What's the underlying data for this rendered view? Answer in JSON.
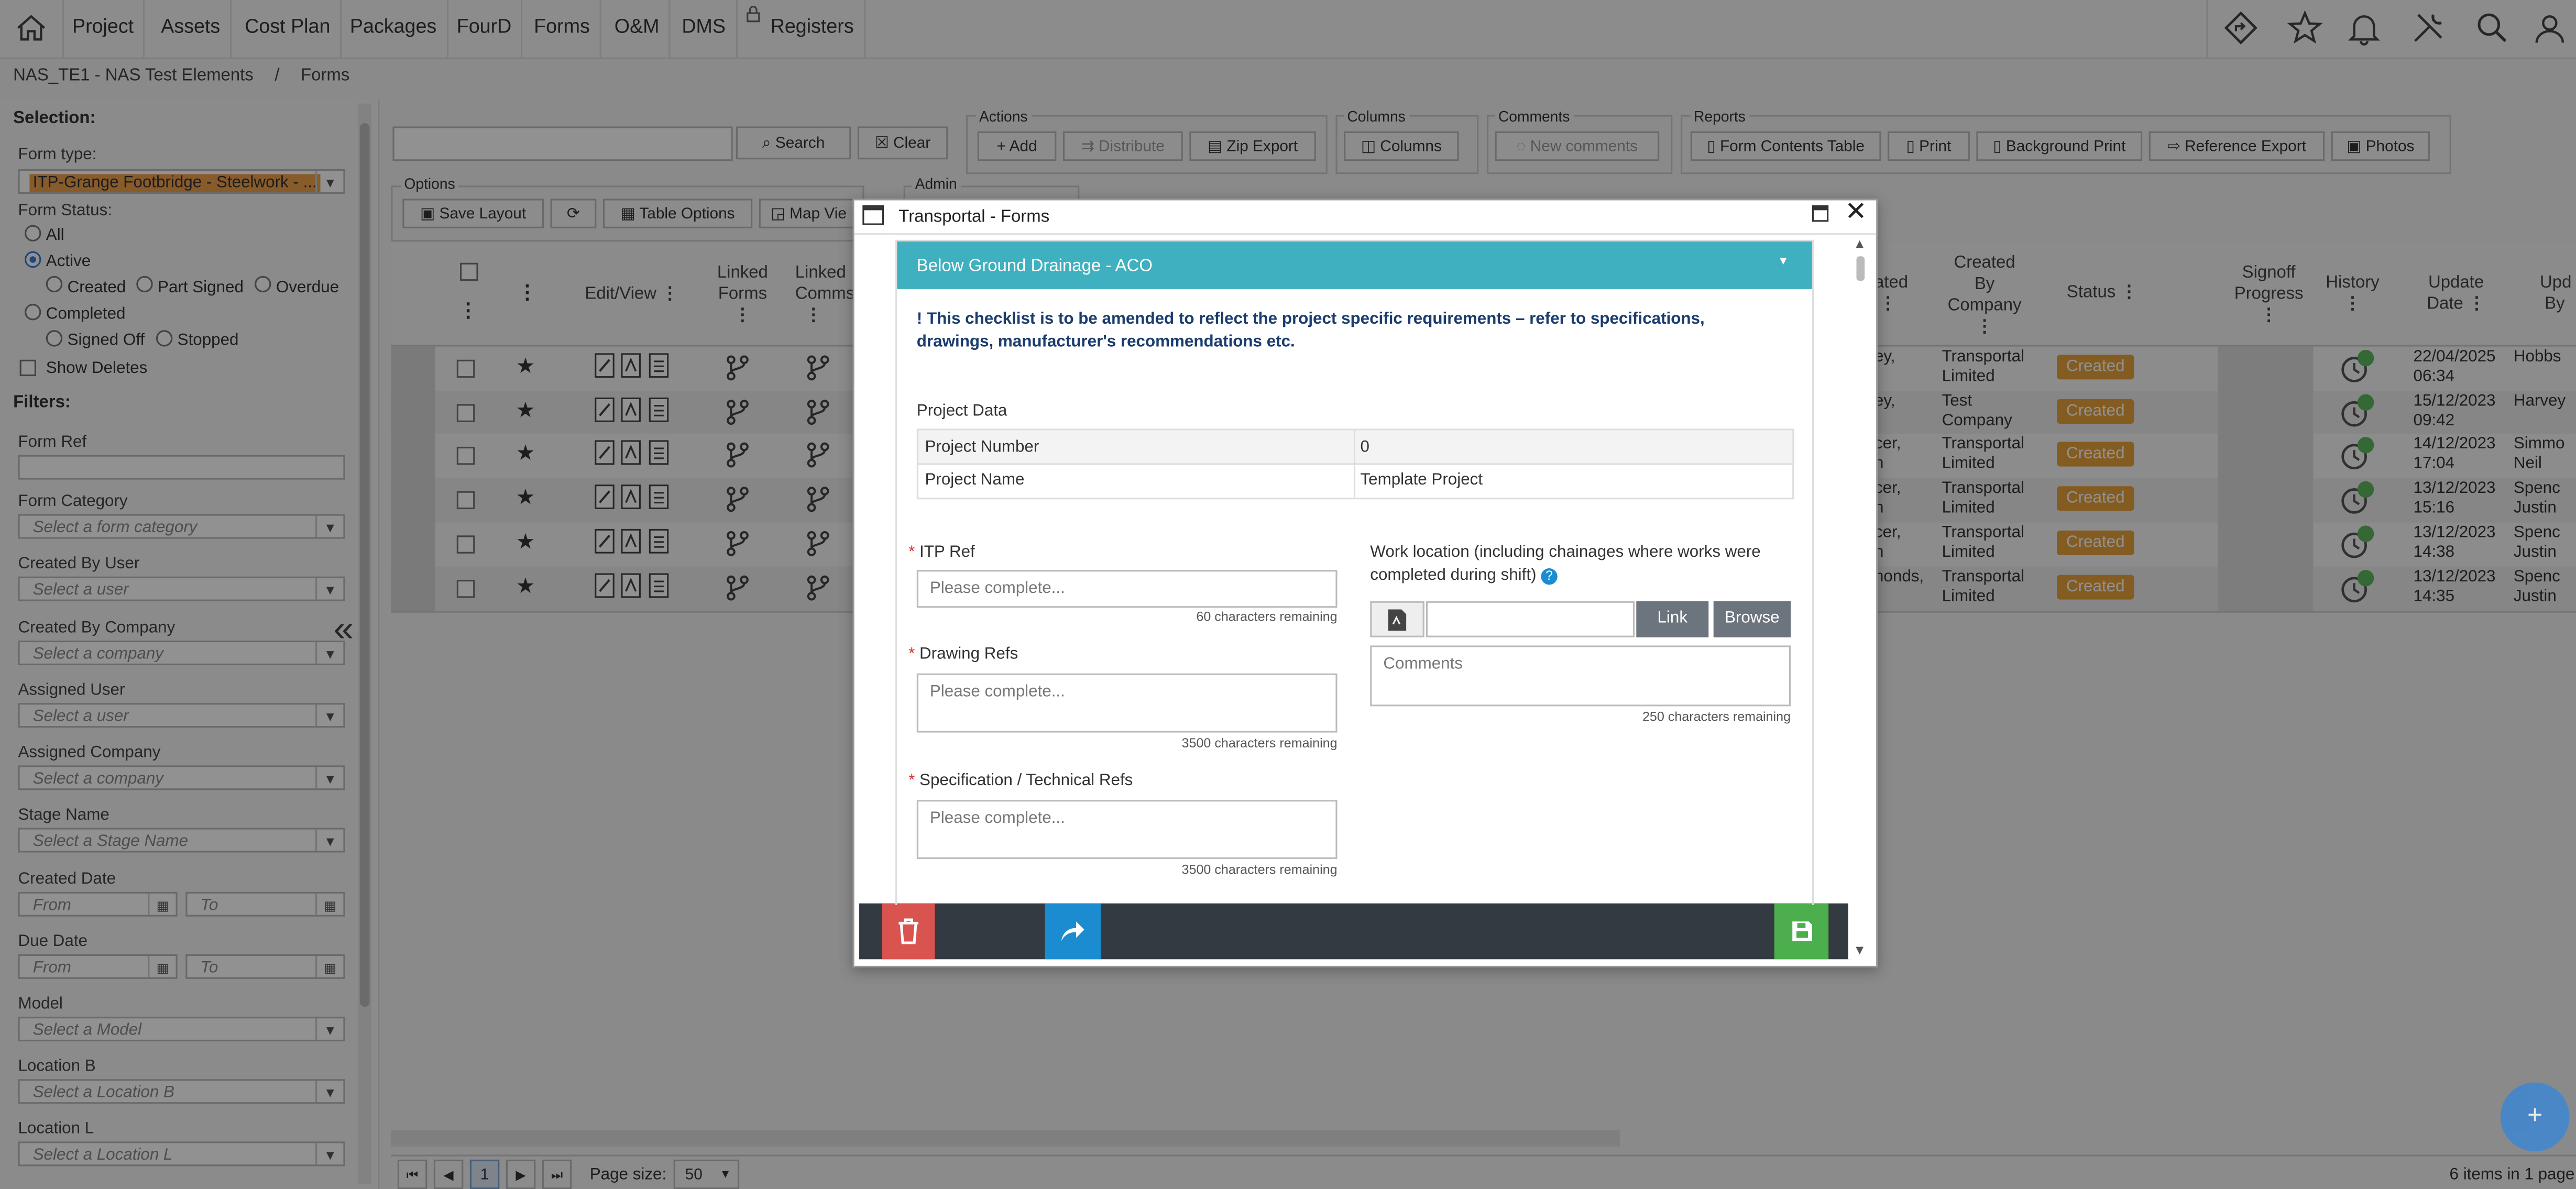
{
  "nav": {
    "items": [
      "Project",
      "Assets",
      "Cost Plan",
      "Packages",
      "FourD",
      "Forms",
      "O&M",
      "DMS",
      "Registers"
    ],
    "right_icons": [
      "directions-icon",
      "star-icon",
      "bell-icon",
      "tools-icon",
      "search-icon",
      "user-icon"
    ]
  },
  "breadcrumb": {
    "project": "NAS_TE1 - NAS Test Elements",
    "separator": "/",
    "page": "Forms"
  },
  "sidebar": {
    "selection_title": "Selection:",
    "form_type_label": "Form type:",
    "form_type_value": "ITP-Grange Footbridge - Steelwork - ...",
    "form_status_label": "Form Status:",
    "status_options": [
      "All",
      "Active",
      "Created",
      "Part Signed",
      "Overdue",
      "Completed",
      "Signed Off",
      "Stopped"
    ],
    "status_selected": "Active",
    "show_deletes": "Show Deletes",
    "filters_title": "Filters:",
    "form_ref_label": "Form Ref",
    "form_category_label": "Form Category",
    "form_category_placeholder": "Select a form category",
    "created_by_user_label": "Created By User",
    "user_placeholder": "Select a user",
    "created_by_company_label": "Created By Company",
    "company_placeholder": "Select a company",
    "assigned_user_label": "Assigned User",
    "assigned_company_label": "Assigned Company",
    "stage_name_label": "Stage Name",
    "stage_name_placeholder": "Select a Stage Name",
    "created_date_label": "Created Date",
    "due_date_label": "Due Date",
    "from_placeholder": "From",
    "to_placeholder": "To",
    "model_label": "Model",
    "model_placeholder": "Select a Model",
    "location_b_label": "Location B",
    "location_b_placeholder": "Select a Location B",
    "location_l_label": "Location L",
    "location_l_placeholder": "Select a Location L"
  },
  "toolbar": {
    "search_label": "Search",
    "clear_label": "Clear",
    "actions_legend": "Actions",
    "add_label": "Add",
    "distribute_label": "Distribute",
    "zip_export_label": "Zip Export",
    "columns_legend": "Columns",
    "columns_label": "Columns",
    "comments_legend": "Comments",
    "new_comments_label": "New comments",
    "reports_legend": "Reports",
    "form_contents_table_label": "Form Contents Table",
    "print_label": "Print",
    "background_print_label": "Background Print",
    "reference_export_label": "Reference Export",
    "photos_label": "Photos",
    "options_legend": "Options",
    "save_layout_label": "Save Layout",
    "table_options_label": "Table Options",
    "map_view_label": "Map Vie",
    "admin_legend": "Admin"
  },
  "grid": {
    "headers": {
      "edit_view": "Edit/View",
      "linked_forms_1": "Linked",
      "linked_forms_2": "Forms",
      "linked_comms_1": "Linked",
      "linked_comms_2": "Comms",
      "created_1": "ated",
      "created_by_company_1": "Created",
      "created_by_company_2": "By Company",
      "status": "Status",
      "signoff_1": "Signoff",
      "signoff_2": "Progress",
      "history": "History",
      "update_date_1": "Update",
      "update_date_2": "Date",
      "updated_by_1": "Upd",
      "updated_by_2": "By"
    },
    "rows": [
      {
        "created_frag1": "ey,",
        "created_frag2": "",
        "company1": "Transportal",
        "company2": "Limited",
        "status": "Created",
        "date1": "22/04/2025",
        "date2": "06:34",
        "by1": "Hobbs",
        "by2": ""
      },
      {
        "created_frag1": "ey,",
        "created_frag2": "",
        "company1": "Test",
        "company2": "Company",
        "status": "Created",
        "date1": "15/12/2023",
        "date2": "09:42",
        "by1": "Harvey",
        "by2": ""
      },
      {
        "created_frag1": "cer,",
        "created_frag2": "n",
        "company1": "Transportal",
        "company2": "Limited",
        "status": "Created",
        "date1": "14/12/2023",
        "date2": "17:04",
        "by1": "Simmo",
        "by2": "Neil"
      },
      {
        "created_frag1": "cer,",
        "created_frag2": "n",
        "company1": "Transportal",
        "company2": "Limited",
        "status": "Created",
        "date1": "13/12/2023",
        "date2": "15:16",
        "by1": "Spenc",
        "by2": "Justin"
      },
      {
        "created_frag1": "cer,",
        "created_frag2": "n",
        "company1": "Transportal",
        "company2": "Limited",
        "status": "Created",
        "date1": "13/12/2023",
        "date2": "14:38",
        "by1": "Spenc",
        "by2": "Justin"
      },
      {
        "created_frag1": "nonds,",
        "created_frag2": "",
        "company1": "Transportal",
        "company2": "Limited",
        "status": "Created",
        "date1": "13/12/2023",
        "date2": "14:35",
        "by1": "Spenc",
        "by2": "Justin"
      }
    ]
  },
  "pager": {
    "current_page": "1",
    "page_size_label": "Page size:",
    "page_size": "50",
    "summary": "6 items in 1 page"
  },
  "modal": {
    "title": "Transportal - Forms",
    "section_title": "Below Ground Drainage - ACO",
    "notice": "! This checklist is to be amended to reflect the project specific requirements – refer to specifications, drawings, manufacturer's recommendations etc.",
    "project_data_title": "Project Data",
    "project_number_label": "Project Number",
    "project_number_value": "0",
    "project_name_label": "Project Name",
    "project_name_value": "Template Project",
    "itp_ref_label": "ITP Ref",
    "itp_ref_placeholder": "Please complete...",
    "itp_ref_remaining": "60 characters remaining",
    "drawing_refs_label": "Drawing Refs",
    "drawing_refs_placeholder": "Please complete...",
    "drawing_refs_remaining": "3500 characters remaining",
    "spec_refs_label": "Specification / Technical Refs",
    "spec_refs_placeholder": "Please complete...",
    "spec_refs_remaining": "3500 characters remaining",
    "work_location_label": "Work location (including chainages where works were completed during shift)",
    "link_label": "Link",
    "browse_label": "Browse",
    "comments_placeholder": "Comments",
    "comments_remaining": "250 characters remaining"
  },
  "colors": {
    "section_header": "#3fb0bf",
    "status_badge": "#e9a23b",
    "delete_button": "#d9534f",
    "forward_button": "#1a8ccf",
    "save_button": "#4cae4c",
    "modal_footer": "#333a42"
  }
}
